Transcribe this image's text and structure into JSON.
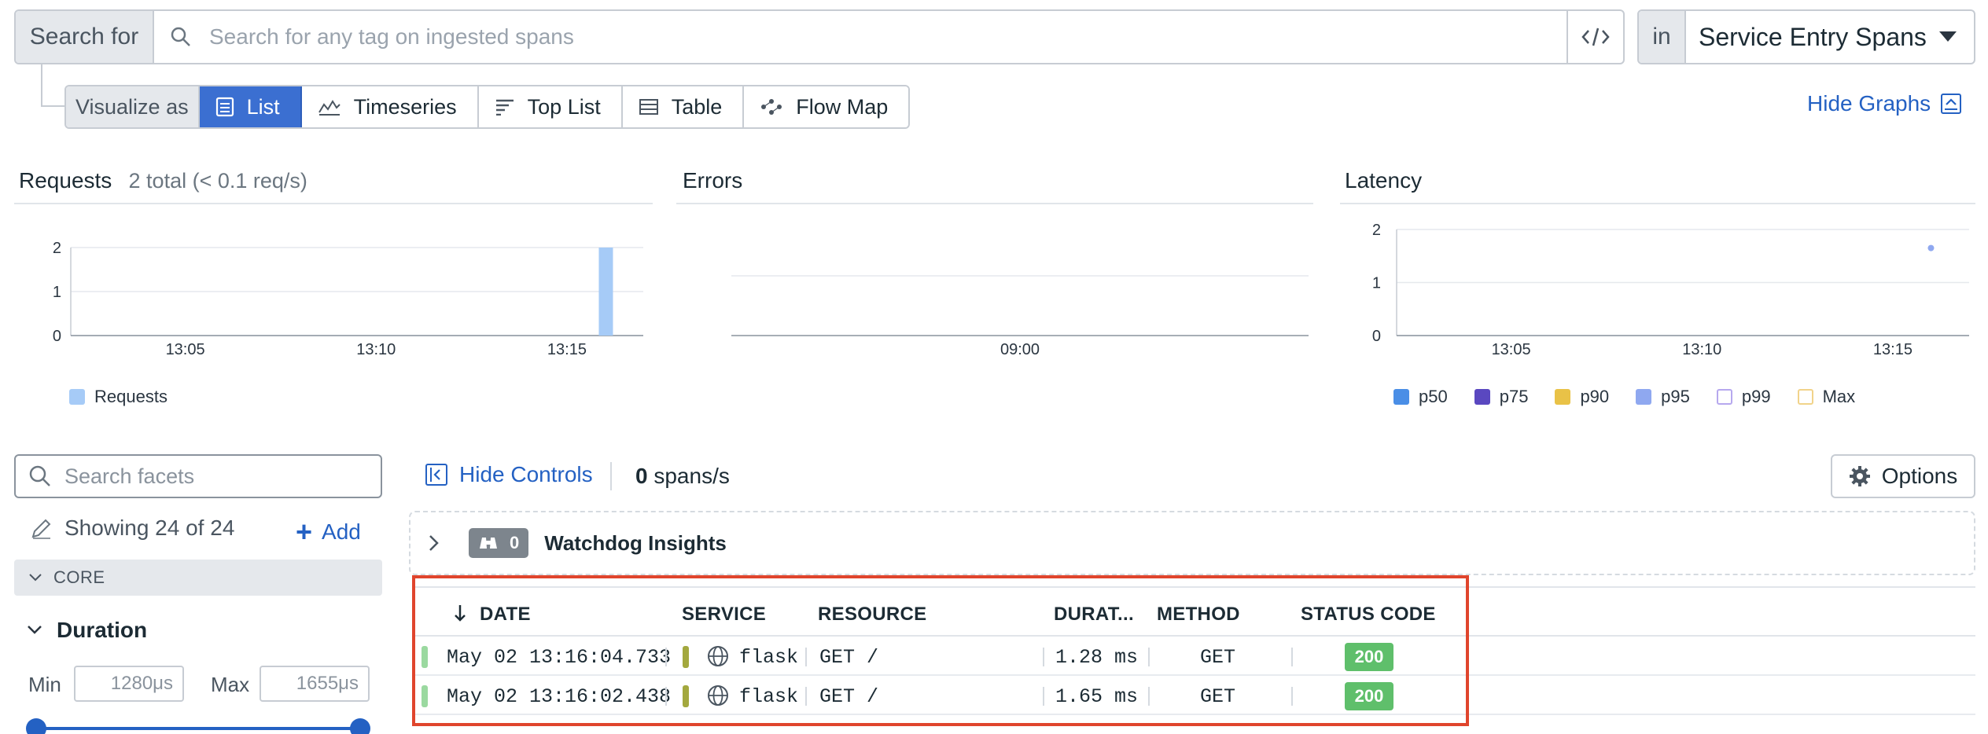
{
  "search": {
    "label": "Search for",
    "placeholder": "Search for any tag on ingested spans",
    "in_label": "in",
    "scope": "Service Entry Spans"
  },
  "visualize": {
    "label": "Visualize as",
    "options": [
      "List",
      "Timeseries",
      "Top List",
      "Table",
      "Flow Map"
    ],
    "active": "List"
  },
  "hide_graphs": "Hide Graphs",
  "graphs": {
    "requests": {
      "title": "Requests",
      "subtitle": "2 total (< 0.1 req/s)",
      "legend": "Requests"
    },
    "errors": {
      "title": "Errors"
    },
    "latency": {
      "title": "Latency",
      "legend": [
        "p50",
        "p75",
        "p90",
        "p95",
        "p99",
        "Max"
      ]
    }
  },
  "chart_data": [
    {
      "type": "bar",
      "x_ticks": [
        "13:05",
        "13:10",
        "13:15"
      ],
      "y_ticks": [
        "0",
        "1",
        "2"
      ],
      "ylim": [
        0,
        2
      ],
      "series": [
        {
          "name": "Requests",
          "points": [
            {
              "x": "13:16",
              "y": 2
            }
          ]
        }
      ],
      "color": "#a6cbf7"
    },
    {
      "type": "line",
      "x_ticks": [
        "09:00"
      ],
      "y_ticks": [],
      "series": []
    },
    {
      "type": "scatter",
      "x_ticks": [
        "13:05",
        "13:10",
        "13:15"
      ],
      "y_ticks": [
        "0",
        "1",
        "2"
      ],
      "ylim": [
        0,
        2
      ],
      "series": [
        {
          "name": "p95",
          "points": [
            {
              "x": "13:16",
              "y": 1.65
            }
          ]
        }
      ],
      "colors": {
        "p50": "#4a8ee6",
        "p75": "#5a48c0",
        "p90": "#e9c247",
        "p95": "#8fa8f0",
        "p99": "#b6a8ee",
        "Max": "#f1d38a"
      }
    }
  ],
  "facets": {
    "search_placeholder": "Search facets",
    "showing": "Showing 24 of 24",
    "add": "Add",
    "core": "CORE",
    "duration": {
      "title": "Duration",
      "min_label": "Min",
      "min_value": "1280μs",
      "max_label": "Max",
      "max_value": "1655μs"
    }
  },
  "controls": {
    "hide_controls": "Hide Controls",
    "spans_count": "0",
    "spans_unit": "spans/s",
    "options": "Options"
  },
  "watchdog": {
    "count": "0",
    "title": "Watchdog Insights"
  },
  "table": {
    "headers": [
      "DATE",
      "SERVICE",
      "RESOURCE",
      "DURAT...",
      "METHOD",
      "STATUS CODE"
    ],
    "rows": [
      {
        "date": "May 02 13:16:04.733",
        "service": "flask",
        "resource": "GET /",
        "duration": "1.28 ms",
        "method": "GET",
        "status": "200"
      },
      {
        "date": "May 02 13:16:02.438",
        "service": "flask",
        "resource": "GET /",
        "duration": "1.65 ms",
        "method": "GET",
        "status": "200"
      }
    ]
  }
}
